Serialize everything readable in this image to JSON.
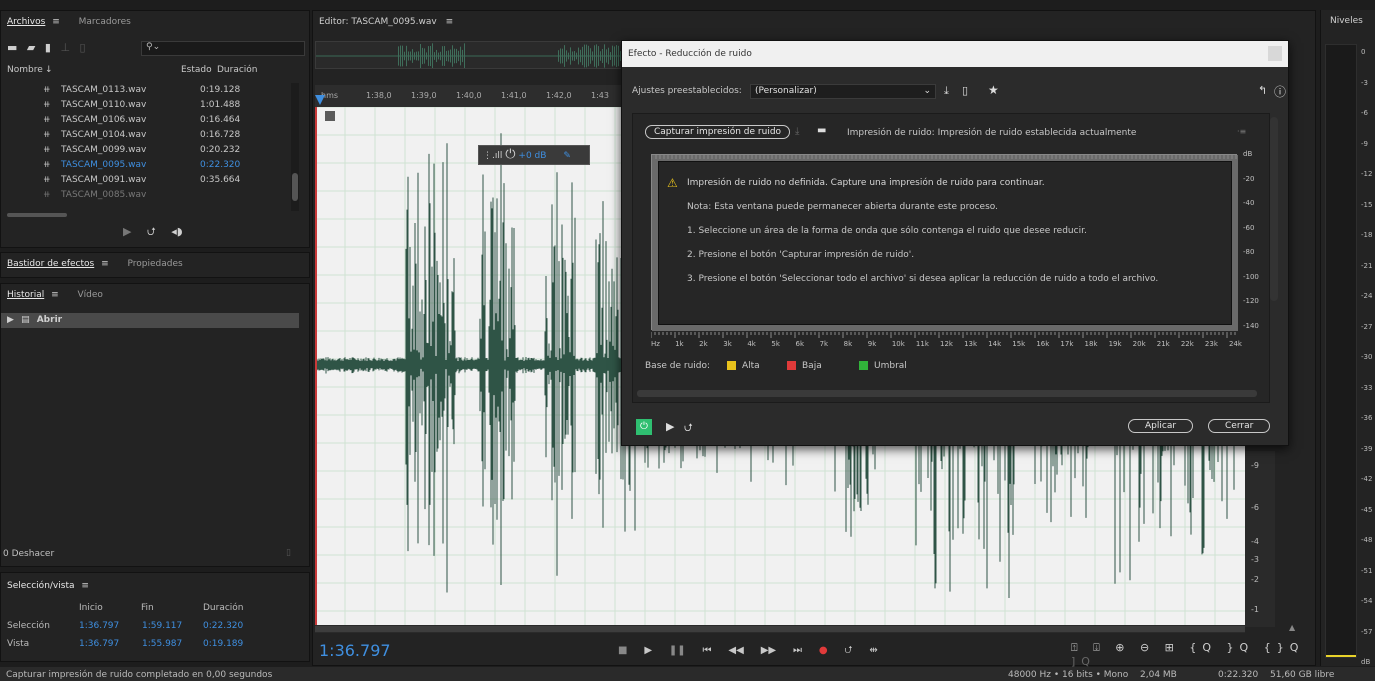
{
  "files_panel": {
    "tab_active": "Archivos",
    "tab_inactive": "Marcadores",
    "col_name": "Nombre",
    "col_state": "Estado",
    "col_duration": "Duración",
    "files": [
      {
        "name": "TASCAM_0113.wav",
        "duration": "0:19.128",
        "selected": false
      },
      {
        "name": "TASCAM_0110.wav",
        "duration": "1:01.488",
        "selected": false
      },
      {
        "name": "TASCAM_0106.wav",
        "duration": "0:16.464",
        "selected": false
      },
      {
        "name": "TASCAM_0104.wav",
        "duration": "0:16.728",
        "selected": false
      },
      {
        "name": "TASCAM_0099.wav",
        "duration": "0:20.232",
        "selected": false
      },
      {
        "name": "TASCAM_0095.wav",
        "duration": "0:22.320",
        "selected": true
      },
      {
        "name": "TASCAM_0091.wav",
        "duration": "0:35.664",
        "selected": false
      }
    ]
  },
  "effects_panel": {
    "tab_active": "Bastidor de efectos",
    "tab_inactive": "Propiedades"
  },
  "history_panel": {
    "tab_active": "Historial",
    "tab_inactive": "Vídeo",
    "item": "Abrir",
    "undo": "0 Deshacer"
  },
  "selection_panel": {
    "title": "Selección/vista",
    "col_start": "Inicio",
    "col_end": "Fin",
    "col_duration": "Duración",
    "sel_label": "Selección",
    "sel_start": "1:36.797",
    "sel_end": "1:59.117",
    "sel_duration": "0:22.320",
    "view_label": "Vista",
    "view_start": "1:36.797",
    "view_end": "1:55.987",
    "view_duration": "0:19.189"
  },
  "editor": {
    "title": "Editor: TASCAM_0095.wav",
    "time_display": "1:36.797",
    "hud_gain": "+0 dB",
    "ruler": [
      "hms",
      "1:38,0",
      "1:39,0",
      "1:40,0",
      "1:41,0",
      "1:42,0",
      "1:43"
    ],
    "db_scale": [
      "-9",
      "-6",
      "-4",
      "-3",
      "-2",
      "-1"
    ]
  },
  "levels": {
    "title": "Niveles",
    "scale": [
      "0",
      "-3",
      "-6",
      "-9",
      "-12",
      "-15",
      "-18",
      "-21",
      "-24",
      "-27",
      "-30",
      "-33",
      "-36",
      "-39",
      "-42",
      "-45",
      "-48",
      "-51",
      "-54",
      "-57",
      "dB"
    ]
  },
  "dialog": {
    "title": "Efecto - Reducción de ruido",
    "preset_label": "Ajustes preestablecidos:",
    "preset_value": "(Personalizar)",
    "capture_button": "Capturar impresión de ruido",
    "noise_print_text": "Impresión de ruido: Impresión de ruido establecida actualmente",
    "warning": "Impresión de ruido no definida. Capture una impresión de ruido para continuar.",
    "note": "Nota: Esta ventana puede permanecer abierta durante este proceso.",
    "step1": "1. Seleccione un área de la forma de onda que sólo contenga el ruido que desee reducir.",
    "step2": "2. Presione el botón 'Capturar impresión de ruido'.",
    "step3": "3. Presione el botón 'Seleccionar todo el archivo' si desea aplicar la reducción de ruido a todo el archivo.",
    "db_labels": [
      "dB",
      "-20",
      "-40",
      "-60",
      "-80",
      "-100",
      "-120",
      "-140"
    ],
    "freq_labels": [
      "Hz",
      "1k",
      "2k",
      "3k",
      "4k",
      "5k",
      "6k",
      "7k",
      "8k",
      "9k",
      "10k",
      "11k",
      "12k",
      "13k",
      "14k",
      "15k",
      "16k",
      "17k",
      "18k",
      "19k",
      "20k",
      "21k",
      "22k",
      "23k",
      "24k"
    ],
    "base_label": "Base de ruido:",
    "legend_high": "Alta",
    "legend_low": "Baja",
    "legend_threshold": "Umbral",
    "color_high": "#e8c21c",
    "color_low": "#e03a3a",
    "color_threshold": "#31b33a",
    "apply": "Aplicar",
    "close": "Cerrar"
  },
  "status": {
    "message": "Capturar impresión de ruido completado en 0,00 segundos",
    "format": "48000 Hz • 16 bits • Mono",
    "size": "2,04 MB",
    "duration": "0:22.320",
    "free": "51,60 GB libre"
  }
}
